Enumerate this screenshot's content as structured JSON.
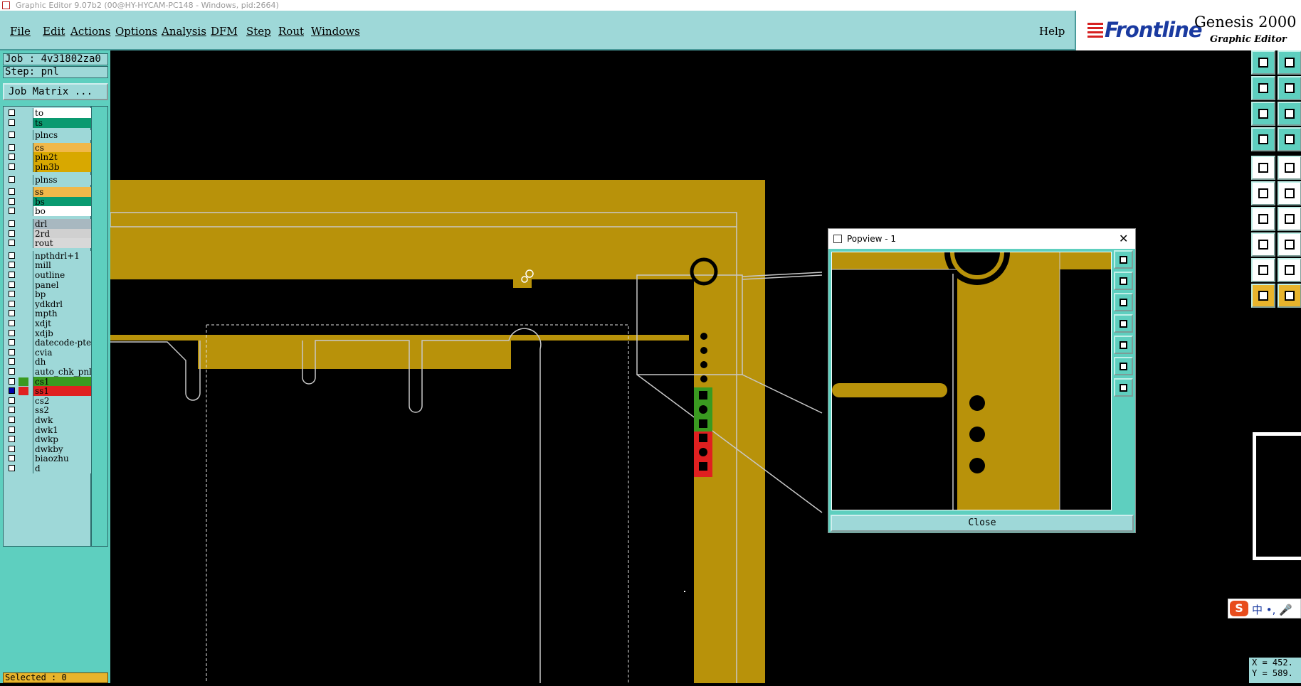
{
  "window": {
    "title": "Graphic Editor 9.07b2 (00@HY-HYCAM-PC148 - Windows, pid:2664)"
  },
  "menu": {
    "items": [
      "File",
      "Edit",
      "Actions",
      "Options",
      "Analysis",
      "DFM",
      "Step",
      "Rout",
      "Windows"
    ],
    "help": "Help"
  },
  "brand": {
    "logo": "Frontline",
    "title": "Genesis 2000",
    "subtitle": "Graphic Editor"
  },
  "job": {
    "job_line": "Job : 4v31802za0",
    "step_line": "Step: pnl",
    "matrix_button": "Job Matrix ..."
  },
  "layers": [
    {
      "name": "to",
      "color": "#ffffff",
      "checked": false
    },
    {
      "name": "ts",
      "color": "#0a9a70",
      "checked": false
    },
    {
      "name": "plncs",
      "color": "#9ed8d8",
      "checked": false
    },
    {
      "name": "cs",
      "color": "#f0b84a",
      "checked": false
    },
    {
      "name": "pln2t",
      "color": "#d8a800",
      "checked": false
    },
    {
      "name": "pln3b",
      "color": "#d8a800",
      "checked": false
    },
    {
      "name": "plnss",
      "color": "#9ed8d8",
      "checked": false
    },
    {
      "name": "ss",
      "color": "#f0b84a",
      "checked": false
    },
    {
      "name": "bs",
      "color": "#0a9a70",
      "checked": false
    },
    {
      "name": "bo",
      "color": "#ffffff",
      "checked": false
    },
    {
      "name": "drl",
      "color": "#a8b8c0",
      "checked": false
    },
    {
      "name": "2rd",
      "color": "#d0d0d0",
      "checked": false
    },
    {
      "name": "rout",
      "color": "#d8d8d8",
      "checked": false
    },
    {
      "name": "npthdrl+1",
      "color": "#9ed8d8",
      "checked": false
    },
    {
      "name": "mill",
      "color": "#9ed8d8",
      "checked": false
    },
    {
      "name": "outline",
      "color": "#9ed8d8",
      "checked": false
    },
    {
      "name": "panel",
      "color": "#9ed8d8",
      "checked": false
    },
    {
      "name": "bp",
      "color": "#9ed8d8",
      "checked": false
    },
    {
      "name": "ydkdrl",
      "color": "#9ed8d8",
      "checked": false
    },
    {
      "name": "mpth",
      "color": "#9ed8d8",
      "checked": false
    },
    {
      "name": "xdjt",
      "color": "#9ed8d8",
      "checked": false
    },
    {
      "name": "xdjb",
      "color": "#9ed8d8",
      "checked": false
    },
    {
      "name": "datecode-pte",
      "color": "#9ed8d8",
      "checked": false
    },
    {
      "name": "cvia",
      "color": "#9ed8d8",
      "checked": false
    },
    {
      "name": "dh",
      "color": "#9ed8d8",
      "checked": false
    },
    {
      "name": "auto_chk_pnl",
      "color": "#9ed8d8",
      "checked": false
    },
    {
      "name": "cs1",
      "color": "#3a9a20",
      "checked": false,
      "swatch": "#3a9a20"
    },
    {
      "name": "ss1",
      "color": "#e02020",
      "checked": true,
      "swatch": "#e02020"
    },
    {
      "name": "cs2",
      "color": "#9ed8d8",
      "checked": false
    },
    {
      "name": "ss2",
      "color": "#9ed8d8",
      "checked": false
    },
    {
      "name": "dwk",
      "color": "#9ed8d8",
      "checked": false
    },
    {
      "name": "dwk1",
      "color": "#9ed8d8",
      "checked": false
    },
    {
      "name": "dwkp",
      "color": "#9ed8d8",
      "checked": false
    },
    {
      "name": "dwkby",
      "color": "#9ed8d8",
      "checked": false
    },
    {
      "name": "biaozhu",
      "color": "#9ed8d8",
      "checked": false
    },
    {
      "name": "d",
      "color": "#9ed8d8",
      "checked": false
    }
  ],
  "status": {
    "selected": "Selected : 0",
    "x": "X = 452.",
    "y": "Y = 589."
  },
  "popview": {
    "title": "Popview - 1",
    "close_label": "Close",
    "close_x": "✕"
  },
  "ime": {
    "logo": "S",
    "text": "中 •, 🎤"
  },
  "colors": {
    "copper": "#b8920a",
    "panel": "#9ed8d8",
    "panel_dark": "#5ecfbf",
    "brand_blue": "#1a3aa0"
  }
}
